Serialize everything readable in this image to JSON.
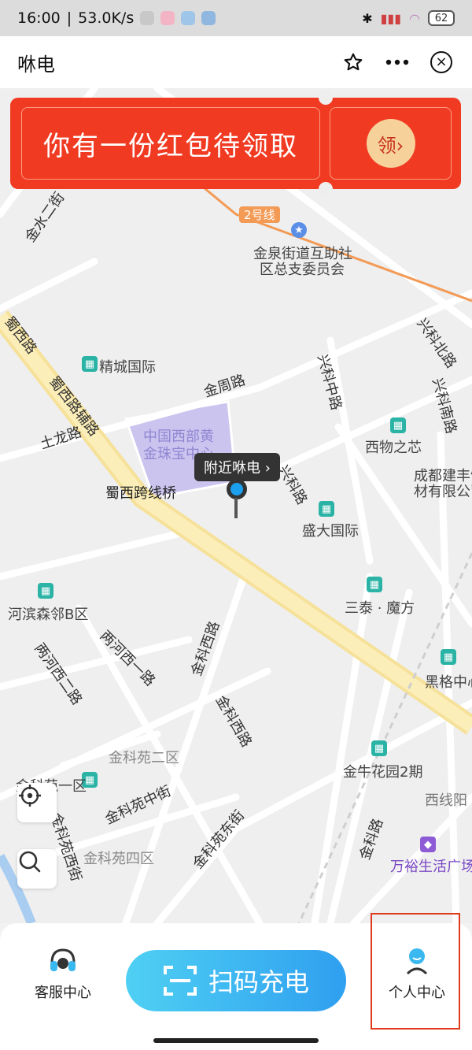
{
  "status_bar": {
    "time": "16:00",
    "net_speed": "53.0K/s",
    "battery": "62"
  },
  "header": {
    "title": "咻电",
    "favorite_icon": "star-outline-icon",
    "more_icon": "more-dots-icon",
    "close_icon": "close-circle-icon"
  },
  "banner": {
    "text": "你有一份红包待领取",
    "claim_label": "领›"
  },
  "map": {
    "marker_tooltip": "附近咻电 ›",
    "labels": {
      "line2": "2号线",
      "jinquan": "金泉街道互助社",
      "jinquan2": "区总支委员会",
      "jingcheng": "精城国际",
      "jinzhoulu": "金周路",
      "shuxi": "蜀西路",
      "shuxi_fulu": "蜀西路辅路",
      "tulong": "土龙路",
      "zhongguo1": "中国西部黄",
      "zhongguo2": "金珠宝中心",
      "shuxi_bridge": "蜀西跨线桥",
      "xingkebei": "兴科北路",
      "xingkezhong": "兴科中路",
      "xingkenan": "兴科南路",
      "xingke": "兴科路",
      "xiwu": "西物之芯",
      "chengdu1": "成都建丰饰",
      "chengdu2": "材有限公司",
      "shengda": "盛大国际",
      "santai": "三泰 · 魔方",
      "hebin": "河滨森邻B区",
      "lianghexi": "两河西一路",
      "lianghexi2": "两河西二路",
      "jinkesi": "金科西路",
      "heige": "黑格中心",
      "jinkexi": "金科西路",
      "jinkeyuan2": "金科苑二区",
      "jinkeyuan1": "金科苑一区",
      "jinkeyuanzhong": "金科苑中街",
      "jinkeyuanxi": "金科苑西街",
      "jinkeyuan4": "金科苑四区",
      "jinkeyuandong": "金科苑东街",
      "jinniu": "金牛花园2期",
      "xixianyang": "西线阳",
      "wanyu": "万裕生活广场",
      "jinkelu": "金科路",
      "jinjin": "金水二街"
    }
  },
  "bottom_bar": {
    "service_label": "客服中心",
    "scan_label": "扫码充电",
    "profile_label": "个人中心"
  },
  "colors": {
    "banner_red": "#f13a22",
    "scan_gradient_start": "#4fd0f3",
    "scan_gradient_end": "#2f9ff0",
    "highlight": "#e03a1e"
  }
}
